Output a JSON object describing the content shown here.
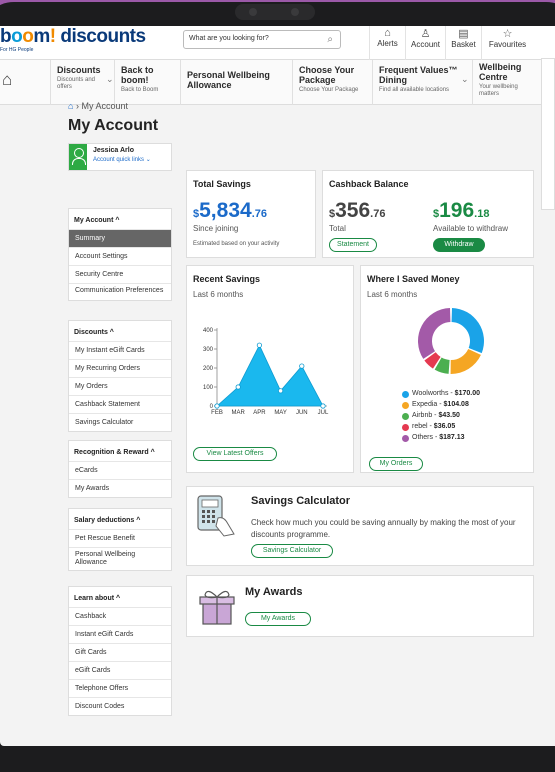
{
  "header": {
    "logo_prefix": "b",
    "logo_o1": "o",
    "logo_o2": "o",
    "logo_suffix": "m",
    "logo_excl": "!",
    "logo_word": "discounts",
    "logo_sub": "For HG People",
    "search_placeholder": "What are you looking for?",
    "alerts": "Alerts",
    "account": "Account",
    "basket": "Basket",
    "favourites": "Favourites"
  },
  "nav": [
    {
      "title": "Discounts",
      "sub": "Discounts and offers"
    },
    {
      "title": "Back to boom!",
      "sub": "Back to Boom"
    },
    {
      "title": "Personal Wellbeing Allowance",
      "sub": ""
    },
    {
      "title": "Choose Your Package",
      "sub": "Choose Your Package"
    },
    {
      "title": "Frequent Values™ Dining",
      "sub": "Find all available locations"
    },
    {
      "title": "Wellbeing Centre",
      "sub": "Your wellbeing matters"
    }
  ],
  "breadcrumb": {
    "current": "My Account"
  },
  "page_title": "My Account",
  "user": {
    "name": "Jessica Arlo",
    "links": "Account quick links ⌄"
  },
  "sidebar": {
    "my_account": {
      "heading": "My Account ^",
      "items": [
        "Summary",
        "Account Settings",
        "Security Centre",
        "Communication Preferences"
      ]
    },
    "discounts": {
      "heading": "Discounts ^",
      "items": [
        "My Instant eGift Cards",
        "My Recurring Orders",
        "My Orders",
        "Cashback Statement",
        "Savings Calculator"
      ]
    },
    "recognition": {
      "heading": "Recognition & Reward ^",
      "items": [
        "eCards",
        "My Awards"
      ]
    },
    "salary": {
      "heading": "Salary deductions ^",
      "items": [
        "Pet Rescue Benefit",
        "Personal Wellbeing Allowance"
      ]
    },
    "learn": {
      "heading": "Learn about ^",
      "items": [
        "Cashback",
        "Instant eGift Cards",
        "Gift Cards",
        "eGift Cards",
        "Telephone Offers",
        "Discount Codes"
      ]
    }
  },
  "total_savings": {
    "title": "Total Savings",
    "currency": "$",
    "amount": "5,834",
    "cents": ".76",
    "label": "Since joining",
    "note": "Estimated based on your activity"
  },
  "cashback": {
    "title": "Cashback Balance",
    "total_currency": "$",
    "total_amount": "356",
    "total_cents": ".76",
    "total_label": "Total",
    "withdraw_currency": "$",
    "withdraw_amount": "196",
    "withdraw_cents": ".18",
    "withdraw_label": "Available to withdraw",
    "statement_button": "Statement",
    "withdraw_button": "Withdraw"
  },
  "recent_savings": {
    "title": "Recent Savings",
    "subtitle": "Last 6 months",
    "button": "View Latest Offers"
  },
  "where_saved": {
    "title": "Where I Saved Money",
    "subtitle": "Last 6 months",
    "button": "My Orders"
  },
  "chart_data": [
    {
      "type": "area",
      "title": "",
      "x": [
        "FEB",
        "MAR",
        "APR",
        "MAY",
        "JUN",
        "JUL"
      ],
      "y_ticks": [
        0,
        100,
        200,
        300,
        400
      ],
      "ylim": [
        0,
        400
      ],
      "values": [
        0,
        100,
        320,
        80,
        210,
        0
      ],
      "color": "#1ab8ee"
    },
    {
      "type": "pie",
      "title": "",
      "slices": [
        {
          "label": "Woolworths",
          "value": 170.0,
          "display": "$170.00",
          "color": "#1aa3e8"
        },
        {
          "label": "Expedia",
          "value": 104.08,
          "display": "$104.08",
          "color": "#f5a623"
        },
        {
          "label": "Airbnb",
          "value": 43.5,
          "display": "$43.50",
          "color": "#4caf50"
        },
        {
          "label": "rebel",
          "value": 36.05,
          "display": "$36.05",
          "color": "#e53950"
        },
        {
          "label": "Others",
          "value": 187.13,
          "display": "$187.13",
          "color": "#a35aa8"
        }
      ]
    }
  ],
  "savings_calculator": {
    "title": "Savings Calculator",
    "text": "Check how much you could be saving annually by making the most of your discounts programme.",
    "button": "Savings Calculator"
  },
  "my_awards": {
    "title": "My Awards",
    "button": "My Awards"
  },
  "colors": {
    "brand_blue": "#0a3a7a",
    "accent_green": "#1a8a44",
    "link_blue": "#1b6ac9",
    "savings_blue": "#1b6ac9"
  }
}
